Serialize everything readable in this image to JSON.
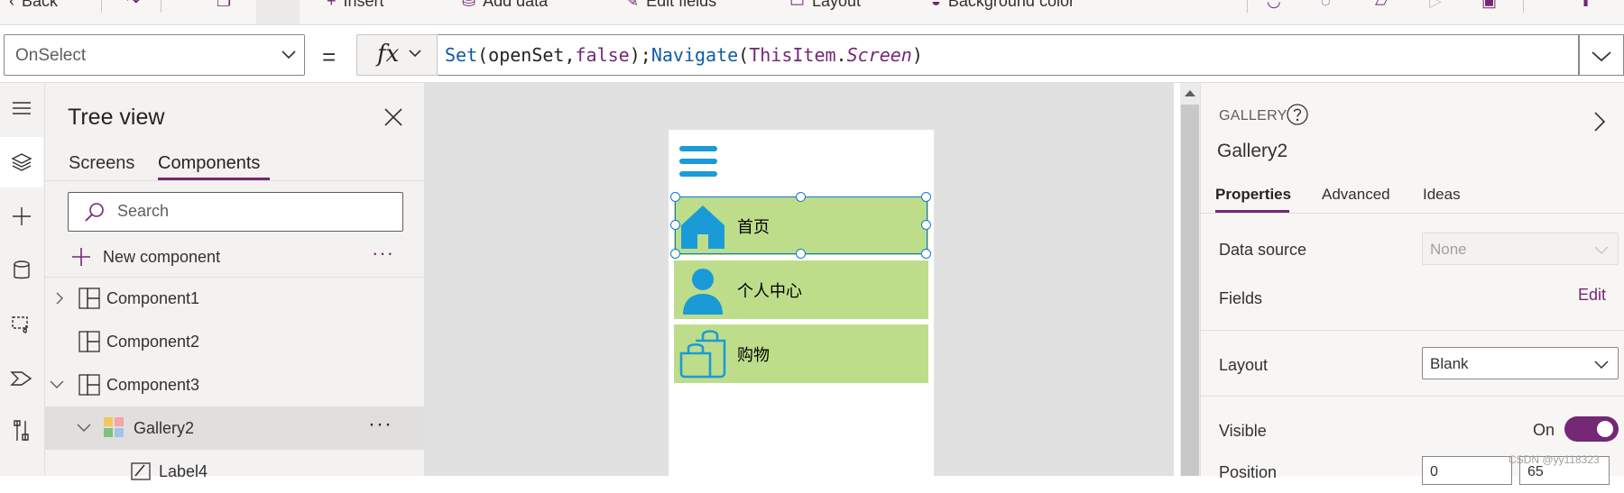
{
  "command_bar": {
    "back_label": "Back",
    "insert_label": "Insert",
    "add_data_label": "Add data",
    "edit_fields_label": "Edit fields",
    "layout_label": "Layout",
    "background_color_label": "Background color"
  },
  "formula_bar": {
    "property": "OnSelect",
    "equals": "=",
    "fx": "fx",
    "tokens": {
      "t0": "Set",
      "t1": "(",
      "t2": "openSet",
      "t3": ",",
      "t4": "false",
      "t5": ");",
      "t6": "Navigate",
      "t7": "(",
      "t8": "ThisItem",
      "t9": ".",
      "t10": "Screen",
      "t11": ")"
    }
  },
  "tree_view": {
    "title": "Tree view",
    "tabs": [
      "Screens",
      "Components"
    ],
    "active_tab": "Components",
    "search_placeholder": "Search",
    "new_component_label": "New component",
    "more_glyph": "···",
    "nodes": [
      {
        "label": "Component1",
        "icon": "component-icon",
        "expanded": false
      },
      {
        "label": "Component2",
        "icon": "component-icon",
        "expanded": false
      },
      {
        "label": "Component3",
        "icon": "component-icon",
        "expanded": true
      },
      {
        "label": "Gallery2",
        "icon": "gallery-icon",
        "expanded": true,
        "selected": true
      },
      {
        "label": "Label4",
        "icon": "label-icon"
      }
    ]
  },
  "canvas": {
    "gallery_items": [
      {
        "label": "首页",
        "icon": "home-icon"
      },
      {
        "label": "个人中心",
        "icon": "person-icon"
      },
      {
        "label": "购物",
        "icon": "shopping-bags-icon"
      }
    ],
    "icon_color": "#1a9bd7",
    "item_color": "#bddd8b"
  },
  "properties": {
    "control_type": "GALLERY",
    "control_name": "Gallery2",
    "tabs": [
      "Properties",
      "Advanced",
      "Ideas"
    ],
    "active_tab": "Properties",
    "data_source_label": "Data source",
    "data_source_value": "None",
    "fields_label": "Fields",
    "fields_edit": "Edit",
    "layout_label": "Layout",
    "layout_value": "Blank",
    "visible_label": "Visible",
    "visible_state": "On",
    "position_label": "Position",
    "position_x": "0",
    "position_y": "65"
  },
  "theme": {
    "accent": "#742774",
    "selection": "#0f78d4"
  },
  "watermark": "CSDN @yy118323"
}
